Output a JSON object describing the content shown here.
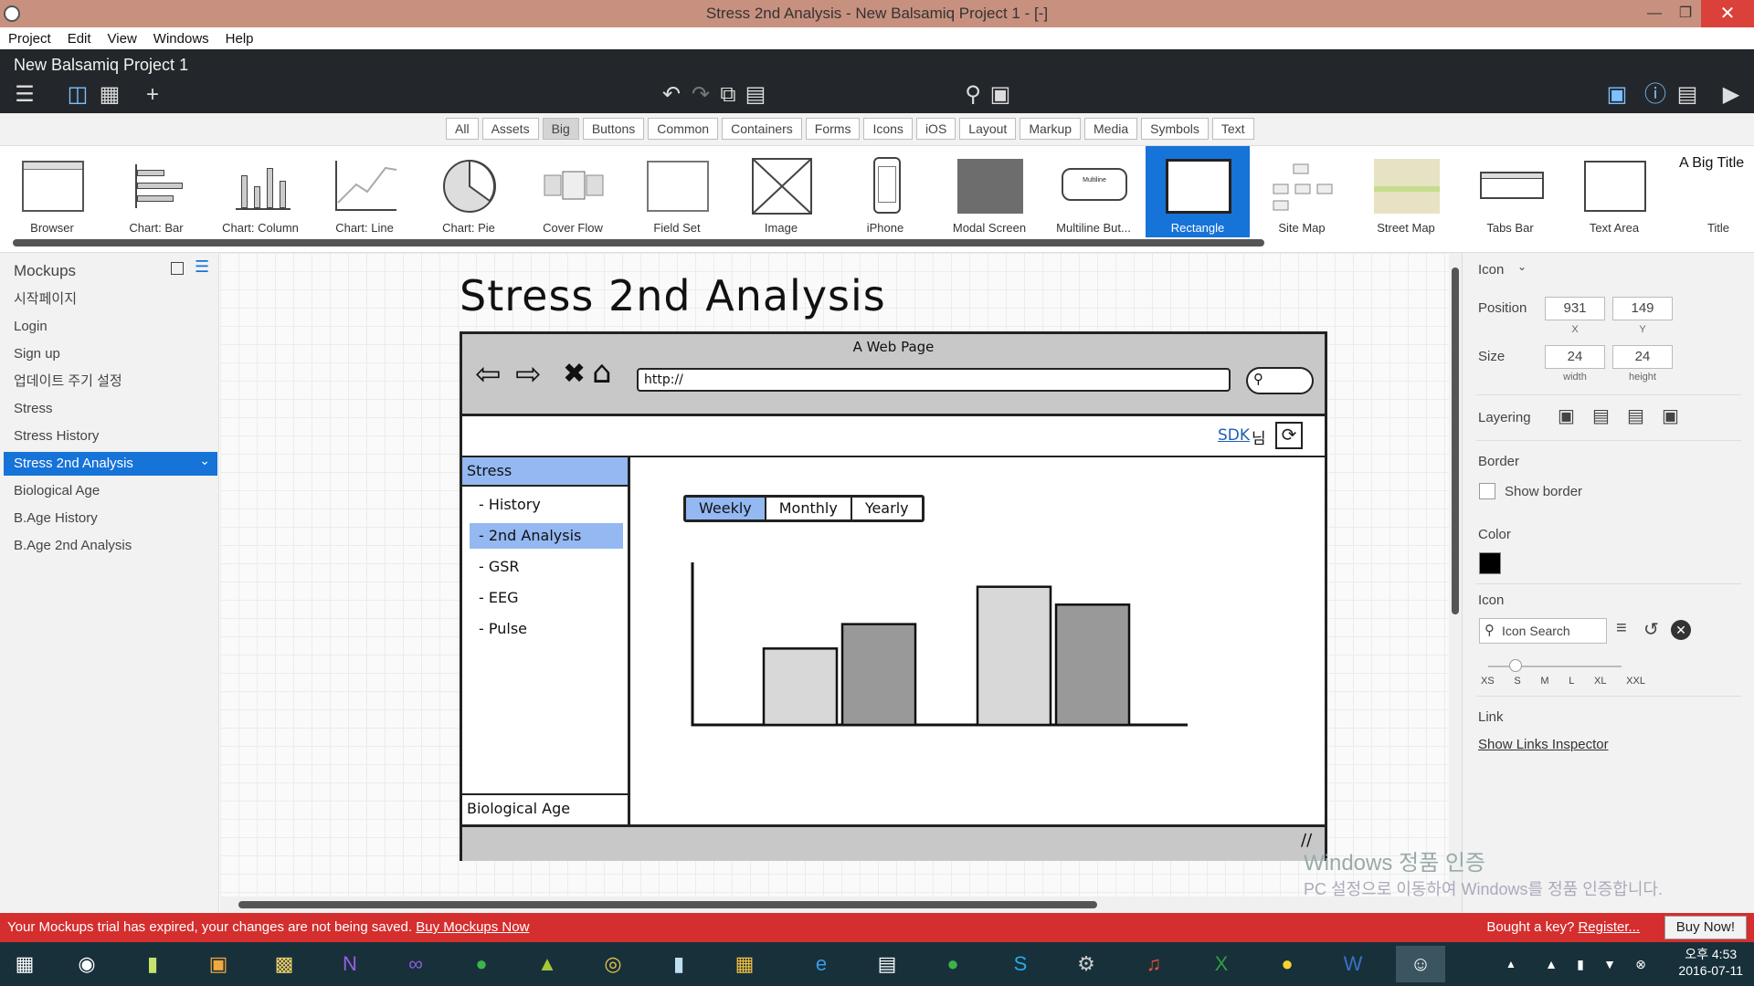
{
  "window": {
    "title": "Stress 2nd Analysis - New Balsamiq Project 1 - [-]"
  },
  "menu": [
    "Project",
    "Edit",
    "View",
    "Windows",
    "Help"
  ],
  "project_name": "New Balsamiq Project 1",
  "library_tabs": [
    "All",
    "Assets",
    "Big",
    "Buttons",
    "Common",
    "Containers",
    "Forms",
    "Icons",
    "iOS",
    "Layout",
    "Markup",
    "Media",
    "Symbols",
    "Text"
  ],
  "library_tabs_active": "Big",
  "library_items": [
    "Browser",
    "Chart: Bar",
    "Chart: Column",
    "Chart: Line",
    "Chart: Pie",
    "Cover Flow",
    "Field Set",
    "Image",
    "iPhone",
    "Modal Screen",
    "Multiline But...",
    "Rectangle",
    "Site Map",
    "Street Map",
    "Tabs Bar",
    "Text Area",
    "Title"
  ],
  "library_selected": "Rectangle",
  "library_title_sample": "A Big Title",
  "mockups_header": "Mockups",
  "mockups": [
    "시작페이지",
    "Login",
    "Sign up",
    "업데이트 주기 설정",
    "Stress",
    "Stress History",
    "Stress 2nd Analysis",
    "Biological Age",
    "B.Age History",
    "B.Age 2nd Analysis"
  ],
  "mockups_selected": "Stress 2nd Analysis",
  "mockup": {
    "title": "Stress 2nd Analysis",
    "browser_title": "A Web Page",
    "url": "http://",
    "user": "SDK",
    "user_suffix": "님",
    "side_header": "Stress",
    "side_items": [
      "- History",
      "- 2nd Analysis",
      "- GSR",
      "- EEG",
      "- Pulse"
    ],
    "side_selected": "- 2nd Analysis",
    "side_footer": "Biological Age",
    "period_tabs": [
      "Weekly",
      "Monthly",
      "Yearly"
    ],
    "period_selected": "Weekly",
    "bars": [
      0.47,
      0.62,
      0.85,
      0.74
    ]
  },
  "inspector": {
    "type_label": "Icon",
    "position_label": "Position",
    "x": "931",
    "x_caption": "X",
    "y": "149",
    "y_caption": "Y",
    "size_label": "Size",
    "width": "24",
    "width_caption": "width",
    "height": "24",
    "height_caption": "height",
    "layering_label": "Layering",
    "border_label": "Border",
    "show_border": "Show border",
    "color_label": "Color",
    "color_value": "#000000",
    "icon_label": "Icon",
    "icon_search_placeholder": "Icon Search",
    "sizes": [
      "XS",
      "S",
      "M",
      "L",
      "XL",
      "XXL"
    ],
    "link_label": "Link",
    "link_action": "Show Links Inspector"
  },
  "trial": {
    "message": "Your Mockups trial has expired, your changes are not being saved.",
    "buy_link": "Buy Mockups Now",
    "key_text": "Bought a key?",
    "register": "Register...",
    "buy_button": "Buy Now!"
  },
  "watermark": {
    "line1": "Windows 정품 인증",
    "line2": "PC 설정으로 이동하여 Windows를 정품 인증합니다."
  },
  "clock": {
    "time": "오후 4:53",
    "date": "2016-07-11"
  }
}
